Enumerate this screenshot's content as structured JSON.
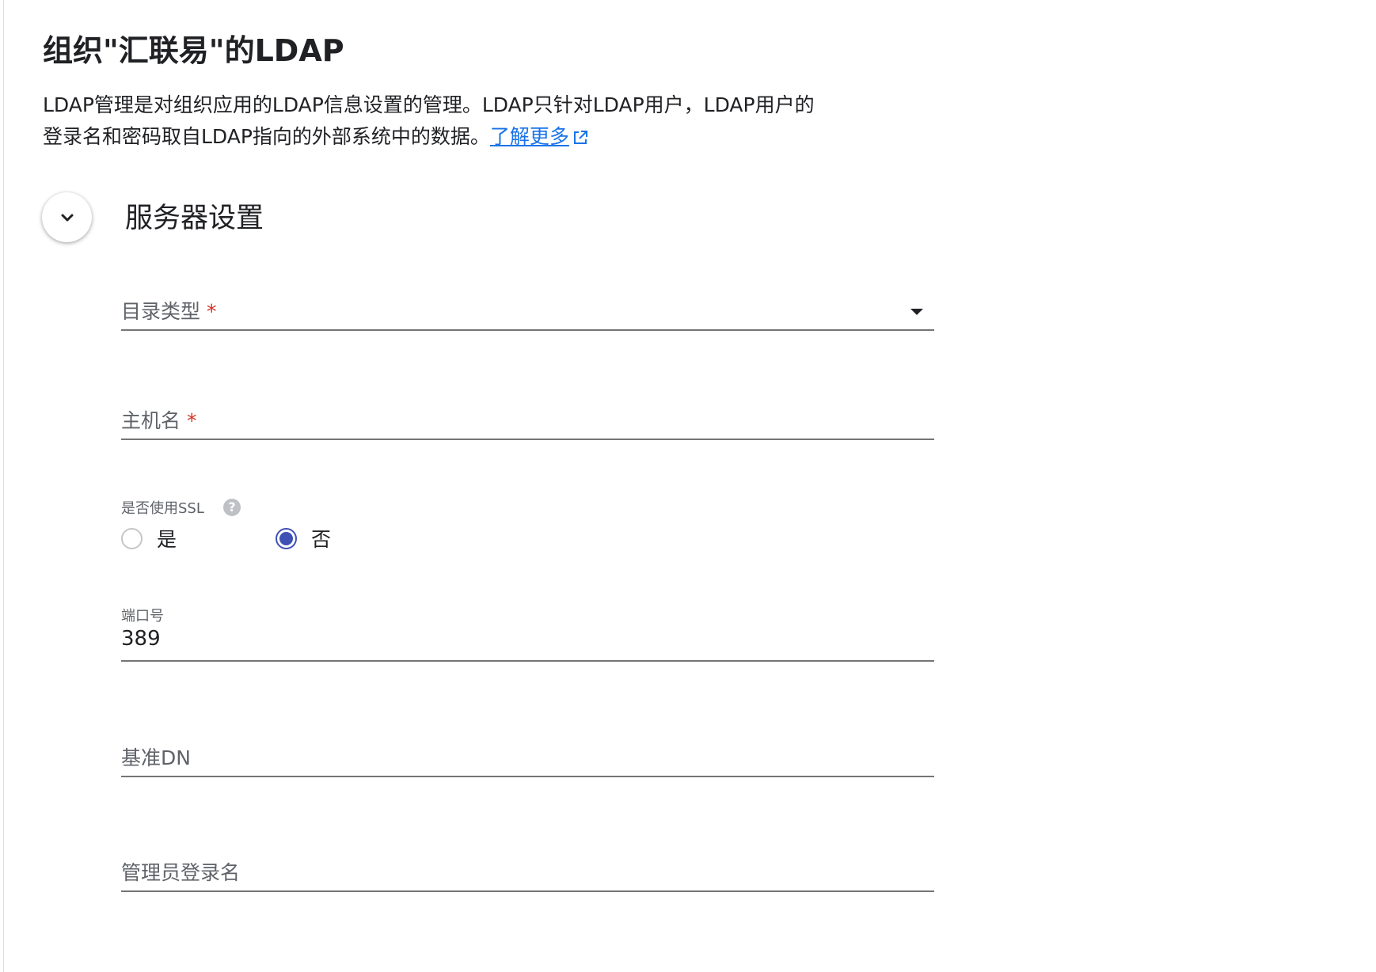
{
  "header": {
    "title": "组织\"汇联易\"的LDAP",
    "description_line1": "LDAP管理是对组织应用的LDAP信息设置的管理。LDAP只针对LDAP用户，LDAP用户的",
    "description_line2": "登录名和密码取自LDAP指向的外部系统中的数据。",
    "learn_more_label": "了解更多"
  },
  "section": {
    "title": "服务器设置",
    "collapse_icon": "chevron-down-icon"
  },
  "form": {
    "directory_type": {
      "label": "目录类型",
      "required_mark": "*",
      "value": ""
    },
    "hostname": {
      "label": "主机名",
      "required_mark": "*",
      "value": ""
    },
    "ssl": {
      "label": "是否使用SSL",
      "help_icon": "question-circle-icon",
      "options": [
        {
          "label": "是",
          "selected": false
        },
        {
          "label": "否",
          "selected": true
        }
      ]
    },
    "port": {
      "label": "端口号",
      "value": "389"
    },
    "base_dn": {
      "label": "基准DN",
      "value": ""
    },
    "admin_login": {
      "label": "管理员登录名",
      "value": ""
    }
  },
  "colors": {
    "accent": "#3f51b5",
    "link": "#1a73e8",
    "required": "#d93025"
  }
}
